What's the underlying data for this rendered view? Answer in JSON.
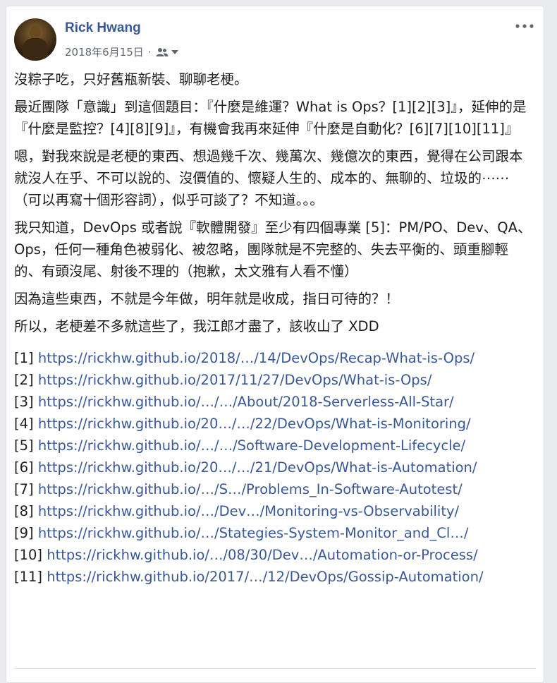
{
  "post": {
    "author": "Rick Hwang",
    "date": "2018年6月15日",
    "date_separator": "·",
    "paragraphs": [
      "沒粽子吃，只好舊瓶新裝、聊聊老梗。",
      "最近團隊「意識」到這個題目：『什麼是維運？What is Ops？[1][2][3]』，延伸的是『什麼是監控？[4][8][9]』，有機會我再來延伸『什麼是自動化？[6][7][10][11]』",
      "嗯，對我來說是老梗的東西、想過幾千次、幾萬次、幾億次的東西，覺得在公司跟本就沒人在乎、不可以說的、沒價值的、懷疑人生的、成本的、無聊的、垃圾的⋯⋯（可以再寫十個形容詞），似乎可談了？不知道。。。",
      "我只知道，DevOps 或者說『軟體開發』至少有四個專業 [5]：PM/PO、Dev、QA、Ops，任何一種角色被弱化、被忽略，團隊就是不完整的、失去平衡的、頭重腳輕的、有頭沒尾、射後不理的（抱歉，太文雅有人看不懂）",
      "因為這些東西，不就是今年做，明年就是收成，指日可待的？！",
      "所以，老梗差不多就這些了，我江郎才盡了，該收山了 XDD"
    ],
    "references": [
      {
        "tag": "[1]",
        "url": "https://rickhw.github.io/2018/…/14/DevOps/Recap-What-is-Ops/"
      },
      {
        "tag": "[2]",
        "url": "https://rickhw.github.io/2017/11/27/DevOps/What-is-Ops/"
      },
      {
        "tag": "[3]",
        "url": "https://rickhw.github.io/…/…/About/2018-Serverless-All-Star/"
      },
      {
        "tag": "[4]",
        "url": "https://rickhw.github.io/20…/…/22/DevOps/What-is-Monitoring/"
      },
      {
        "tag": "[5]",
        "url": "https://rickhw.github.io/…/…/Software-Development-Lifecycle/"
      },
      {
        "tag": "[6]",
        "url": "https://rickhw.github.io/20…/…/21/DevOps/What-is-Automation/"
      },
      {
        "tag": "[7]",
        "url": "https://rickhw.github.io/…/S…/Problems_In-Software-Autotest/"
      },
      {
        "tag": "[8]",
        "url": "https://rickhw.github.io/…/Dev…/Monitoring-vs-Observability/"
      },
      {
        "tag": "[9]",
        "url": "https://rickhw.github.io/…/Stategies-System-Monitor_and_Cl…/"
      },
      {
        "tag": "[10]",
        "url": "https://rickhw.github.io/…/08/30/Dev…/Automation-or-Process/"
      },
      {
        "tag": "[11]",
        "url": "https://rickhw.github.io/2017/…/12/DevOps/Gossip-Automation/"
      }
    ]
  },
  "icons": {
    "audience": "friends-icon",
    "audience_menu": "caret-down-icon",
    "options": "more-options-icon"
  },
  "colors": {
    "author": "#385898",
    "link": "#385898",
    "text": "#1c1e21",
    "meta": "#616770"
  }
}
